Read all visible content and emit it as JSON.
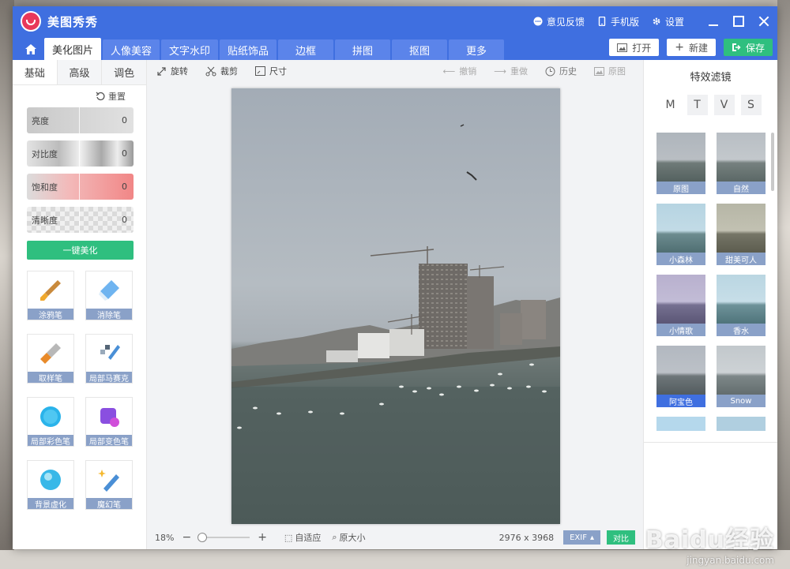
{
  "app": {
    "name": "美图秀秀"
  },
  "titlebar": {
    "feedback": "意见反馈",
    "mobile": "手机版",
    "settings": "设置"
  },
  "nav": {
    "tabs": [
      "美化图片",
      "人像美容",
      "文字水印",
      "贴纸饰品",
      "边框",
      "拼图",
      "抠图",
      "更多"
    ],
    "active_tab": "美化图片",
    "open": "打开",
    "new": "新建",
    "save": "保存"
  },
  "left": {
    "subtabs": [
      "基础",
      "高级",
      "调色"
    ],
    "reset": "重置",
    "sliders": [
      {
        "label": "亮度",
        "value": "0"
      },
      {
        "label": "对比度",
        "value": "0"
      },
      {
        "label": "饱和度",
        "value": "0"
      },
      {
        "label": "清晰度",
        "value": "0"
      }
    ],
    "beautify": "一键美化",
    "tools": [
      "涂鸦笔",
      "消除笔",
      "取样笔",
      "局部马赛克",
      "局部彩色笔",
      "局部变色笔",
      "背景虚化",
      "魔幻笔"
    ]
  },
  "toolbar": {
    "rotate": "旋转",
    "crop": "裁剪",
    "size": "尺寸",
    "undo": "撤销",
    "redo": "重做",
    "history": "历史",
    "original": "原图"
  },
  "status": {
    "zoom": "18%",
    "fit": "自适应",
    "actual": "原大小",
    "dimensions": "2976 x 3968",
    "exif": "EXIF",
    "compare": "对比"
  },
  "right": {
    "title": "特效滤镜",
    "categories": [
      "M",
      "T",
      "V",
      "S"
    ],
    "filters": [
      "原图",
      "自然",
      "小森林",
      "甜美可人",
      "小情歌",
      "香水",
      "阿宝色",
      "Snow"
    ],
    "active_filter": "阿宝色"
  },
  "watermark": {
    "brand": "Baidu经验",
    "url": "jingyan.baidu.com"
  }
}
